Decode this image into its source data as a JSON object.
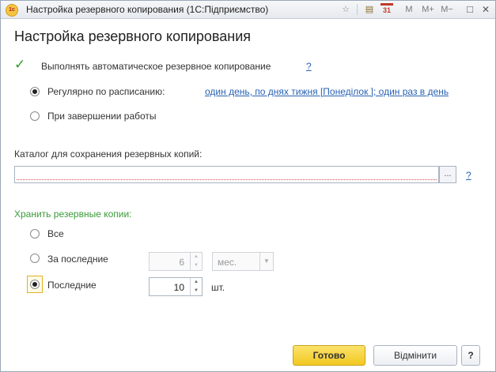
{
  "window": {
    "title": "Настройка резервного копирования  (1С:Підприємство)",
    "app_icon": "1с",
    "toolbar": {
      "star_icon": "☆",
      "doc_icon": "▤",
      "calendar_icon": "31",
      "m": "M",
      "m_plus": "M+",
      "m_minus": "M−",
      "restore_icon": "□",
      "close_icon": "✕"
    }
  },
  "form": {
    "heading": "Настройка резервного копирования",
    "auto_backup": {
      "label": "Выполнять автоматическое резервное копирование",
      "checked": true,
      "help": "?"
    },
    "schedule": {
      "regular_label": "Регулярно по расписанию:",
      "regular_link": "один день, по днях тижня [Понеділок ]; один раз в день",
      "on_exit_label": "При завершении работы",
      "selected": "regular"
    },
    "catalog": {
      "label": "Каталог для сохранения резервных копий:",
      "value": "",
      "browse": "...",
      "help": "?"
    },
    "keep": {
      "title": "Хранить резервные копии:",
      "all_label": "Все",
      "last_period_label": "За последние",
      "period_value": "6",
      "period_unit": "мес.",
      "last_count_label": "Последние",
      "count_value": "10",
      "count_unit": "шт.",
      "selected": "last_count"
    }
  },
  "buttons": {
    "ok": "Готово",
    "cancel": "Відмінити",
    "help": "?"
  },
  "colors": {
    "accent_link": "#2962b3",
    "group_title": "#3a9a3a",
    "primary_button": "#f2c820"
  }
}
